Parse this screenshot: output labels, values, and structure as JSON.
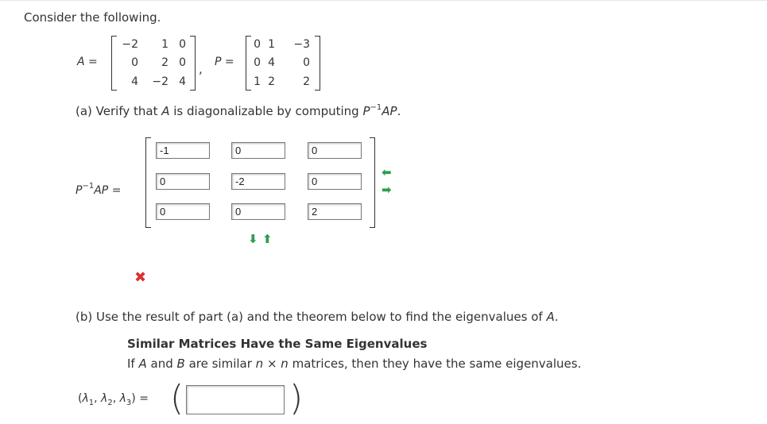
{
  "intro": "Consider the following.",
  "matrix_A": {
    "label": "A",
    "rows": [
      [
        "−2",
        "1",
        "0"
      ],
      [
        "0",
        "2",
        "0"
      ],
      [
        "4",
        "−2",
        "4"
      ]
    ]
  },
  "matrix_P": {
    "label": "P",
    "rows": [
      [
        "0",
        "1",
        "−3"
      ],
      [
        "0",
        "4",
        "0"
      ],
      [
        "1",
        "2",
        "2"
      ]
    ]
  },
  "eq": "=",
  "comma": ",",
  "part_a": {
    "text_before": "(a) Verify that ",
    "var": "A",
    "text_after": " is diagonalizable by computing ",
    "expr_p": "P",
    "expr_sup": "−1",
    "expr_ap": "AP",
    "period": "."
  },
  "lhs": {
    "p": "P",
    "sup": "−1",
    "ap": "AP",
    "eq": "="
  },
  "answer_grid": [
    [
      "-1",
      "0",
      "0"
    ],
    [
      "0",
      "-2",
      "0"
    ],
    [
      "0",
      "0",
      "2"
    ]
  ],
  "arrows": {
    "row_left": "⬅",
    "row_right": "➡",
    "col_down": "⬇",
    "col_up": "⬆"
  },
  "feedback_mark": "✖",
  "part_b": {
    "text": "(b) Use the result of part (a) and the theorem below to find the eigenvalues of ",
    "var": "A",
    "period": "."
  },
  "theorem": {
    "title": "Similar Matrices Have the Same Eigenvalues",
    "body_if": "If ",
    "a": "A",
    "and": " and ",
    "b": "B",
    "mid": " are similar ",
    "n1": "n",
    "times": " × ",
    "n2": "n",
    "end": " matrices, then they have the same eigenvalues."
  },
  "eigen": {
    "open": "(",
    "l1": "λ",
    "s1": "1",
    "sep1": ", ",
    "l2": "λ",
    "s2": "2",
    "sep2": ", ",
    "l3": "λ",
    "s3": "3",
    "close": ")",
    "eq": "=",
    "value": ""
  },
  "colors": {
    "arrow": "#2e9e4f",
    "wrong": "#d9312f"
  }
}
